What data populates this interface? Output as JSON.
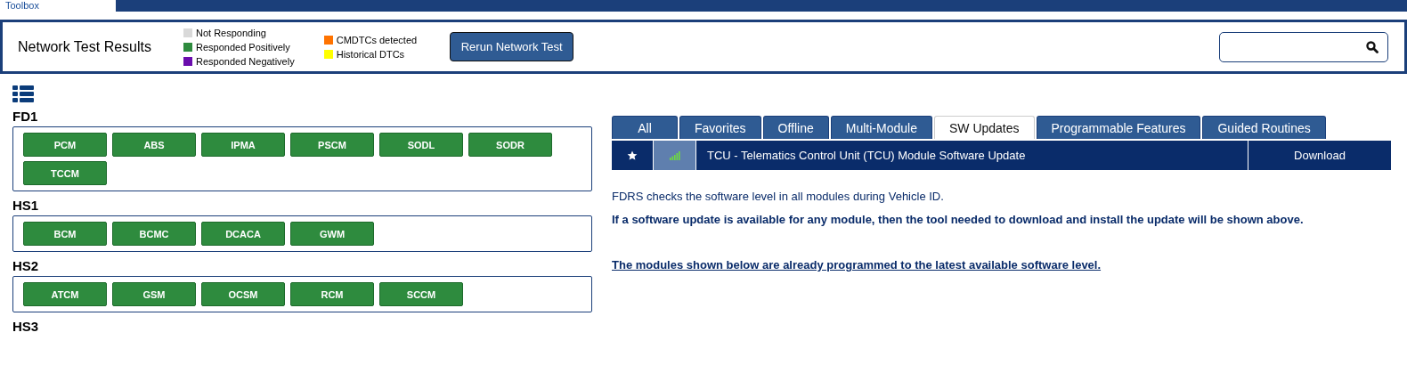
{
  "top_tab": {
    "label": "Toolbox",
    "selected": true
  },
  "header": {
    "title": "Network Test Results",
    "legend": [
      {
        "label": "Not Responding",
        "color": "#d9d9d9"
      },
      {
        "label": "Responded Positively",
        "color": "#2e8b3e"
      },
      {
        "label": "Responded Negatively",
        "color": "#6a0dad"
      },
      {
        "label": "CMDTCs detected",
        "color": "#ff7300"
      },
      {
        "label": "Historical DTCs",
        "color": "#ffff00"
      }
    ],
    "rerun_button": "Rerun Network Test"
  },
  "networks": [
    {
      "name": "FD1",
      "modules": [
        {
          "label": "PCM",
          "color": "#2e8b3e"
        },
        {
          "label": "ABS",
          "color": "#2e8b3e"
        },
        {
          "label": "IPMA",
          "color": "#2e8b3e"
        },
        {
          "label": "PSCM",
          "color": "#2e8b3e"
        },
        {
          "label": "SODL",
          "color": "#2e8b3e"
        },
        {
          "label": "SODR",
          "color": "#2e8b3e"
        },
        {
          "label": "TCCM",
          "color": "#2e8b3e"
        }
      ]
    },
    {
      "name": "HS1",
      "modules": [
        {
          "label": "BCM",
          "color": "#2e8b3e"
        },
        {
          "label": "BCMC",
          "color": "#2e8b3e"
        },
        {
          "label": "DCACA",
          "color": "#2e8b3e"
        },
        {
          "label": "GWM",
          "color": "#2e8b3e"
        }
      ]
    },
    {
      "name": "HS2",
      "modules": [
        {
          "label": "ATCM",
          "color": "#2e8b3e"
        },
        {
          "label": "GSM",
          "color": "#2e8b3e"
        },
        {
          "label": "OCSM",
          "color": "#2e8b3e"
        },
        {
          "label": "RCM",
          "color": "#2e8b3e"
        },
        {
          "label": "SCCM",
          "color": "#2e8b3e"
        }
      ]
    },
    {
      "name": "HS3"
    }
  ],
  "tabs": [
    {
      "label": "All",
      "selected": false
    },
    {
      "label": "Favorites",
      "selected": false
    },
    {
      "label": "Offline",
      "selected": false
    },
    {
      "label": "Multi-Module",
      "selected": false
    },
    {
      "label": "SW Updates",
      "selected": true
    },
    {
      "label": "Programmable Features",
      "selected": false
    },
    {
      "label": "Guided Routines",
      "selected": false
    }
  ],
  "updates": [
    {
      "title": "TCU - Telematics Control Unit (TCU) Module Software Update",
      "action": "Download"
    }
  ],
  "info": [
    {
      "text": "FDRS checks the software level in all modules during Vehicle ID.",
      "kind": "plain"
    },
    {
      "text": "If a software update is available for any module, then the tool needed to download and install the update will be shown above.",
      "kind": "bold"
    },
    {
      "text": "The modules shown below are already programmed to the latest available software level.",
      "kind": "link"
    }
  ]
}
